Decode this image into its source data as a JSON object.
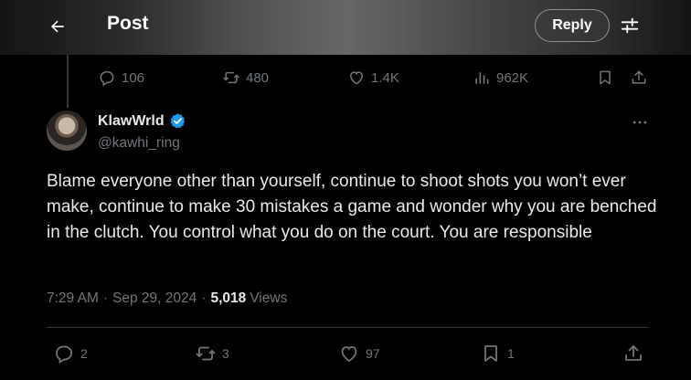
{
  "header": {
    "title": "Post",
    "reply_label": "Reply",
    "back_icon": "arrow-left-icon",
    "settings_icon": "sliders-icon"
  },
  "previous_post_actions": {
    "replies": "106",
    "reposts": "480",
    "likes": "1.4K",
    "views": "962K"
  },
  "post": {
    "display_name": "KlawWrld",
    "verified": true,
    "handle": "@kawhi_ring",
    "text": "Blame everyone other than yourself, continue to shoot shots you won’t ever make, continue to make 30 mistakes a game and wonder why you are benched in the clutch. You control what you do on the court. You are responsible",
    "time": "7:29 AM",
    "date": "Sep 29, 2024",
    "views_count": "5,018",
    "views_label": "Views",
    "separator": "·"
  },
  "post_actions": {
    "replies": "2",
    "reposts": "3",
    "likes": "97",
    "bookmarks": "1"
  },
  "colors": {
    "background": "#000000",
    "text_primary": "#e7e9ea",
    "text_secondary": "#71767b",
    "verified_badge": "#1d9bf0",
    "divider": "#2f3336"
  }
}
